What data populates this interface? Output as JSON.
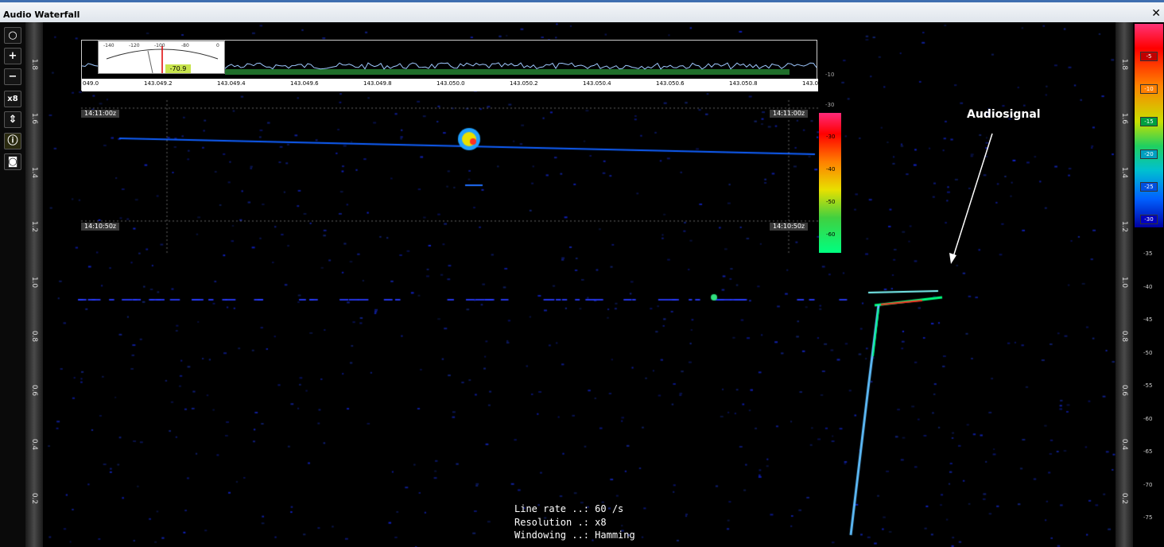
{
  "window": {
    "title": "Audio Waterfall",
    "close_glyph": "✕"
  },
  "toolbar": {
    "buttons": [
      {
        "icon": "circle-icon",
        "label": "○"
      },
      {
        "icon": "plus-icon",
        "label": "+"
      },
      {
        "icon": "minus-icon",
        "label": "−"
      },
      {
        "icon": "zoom-label",
        "label": "x8"
      },
      {
        "icon": "arrows-updown-icon",
        "label": "⇕"
      },
      {
        "icon": "info-icon",
        "label": "ⓘ"
      },
      {
        "icon": "camera-icon",
        "label": "◙"
      }
    ]
  },
  "axis": {
    "left_ticks": [
      "1.8",
      "1.6",
      "1.4",
      "1.2",
      "1.0",
      "0.8",
      "0.6",
      "0.4",
      "0.2"
    ],
    "right_ticks": [
      "1.8",
      "1.6",
      "1.4",
      "1.2",
      "1.0",
      "0.8",
      "0.6",
      "0.4",
      "0.2"
    ]
  },
  "colorscale": {
    "top_labels": [
      "-5",
      "-10",
      "-15",
      "-20",
      "-25",
      "-30"
    ],
    "db_labels": [
      "-35",
      "-40",
      "-45",
      "-50",
      "-55",
      "-60",
      "-65",
      "-70",
      "-75"
    ]
  },
  "mini_spectrum": {
    "smeter_value": "-70.9",
    "smeter_labels": [
      "-140",
      "-120",
      "-100",
      "-80",
      "0"
    ],
    "freq_labels": [
      "049.0",
      "143.049.2",
      "143.049.4",
      "143.049.6",
      "143.049.8",
      "143.050.0",
      "143.050.2",
      "143.050.4",
      "143.050.6",
      "143.050.8",
      "143.0"
    ],
    "time_top": "14:11:00z",
    "time_bottom": "14:10:50z",
    "scale_labels": [
      "-10",
      "-30"
    ],
    "color_labels": [
      "-30",
      "-40",
      "-50",
      "-60"
    ]
  },
  "annotation": {
    "text": "Audiosignal"
  },
  "info": {
    "line_rate": "Line rate ..: 60 /s",
    "resolution": "Resolution .: x8",
    "windowing": "Windowing ..: Hamming"
  }
}
